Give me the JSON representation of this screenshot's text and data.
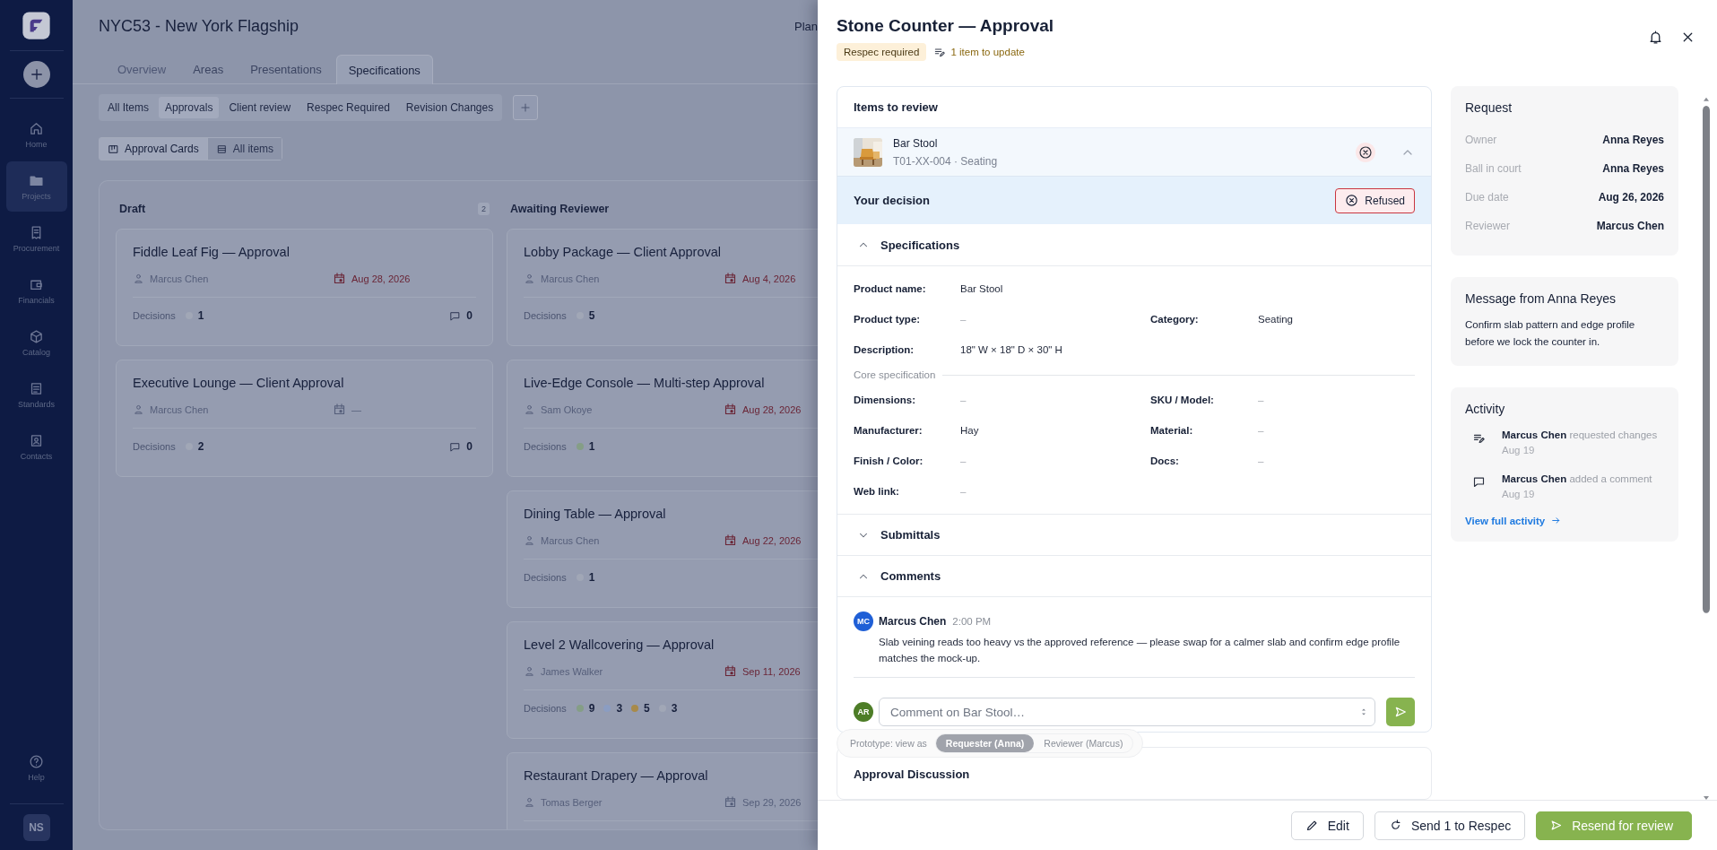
{
  "sidebar": {
    "items": [
      {
        "label": "Home",
        "selected": false
      },
      {
        "label": "Projects",
        "selected": true
      },
      {
        "label": "Procurement",
        "selected": false
      },
      {
        "label": "Financials",
        "selected": false
      },
      {
        "label": "Catalog",
        "selected": false
      },
      {
        "label": "Standards",
        "selected": false
      },
      {
        "label": "Contacts",
        "selected": false
      }
    ],
    "help": "Help",
    "avatar": "NS"
  },
  "project": {
    "title": "NYC53 - New York Flagship",
    "header_right": "Plan"
  },
  "tabs": [
    {
      "label": "Overview",
      "selected": false,
      "disabled": true
    },
    {
      "label": "Areas",
      "selected": false,
      "disabled": false
    },
    {
      "label": "Presentations",
      "selected": false,
      "disabled": false
    },
    {
      "label": "Specifications",
      "selected": true,
      "disabled": false
    }
  ],
  "subtabs": [
    {
      "label": "All Items",
      "selected": false
    },
    {
      "label": "Approvals",
      "selected": true
    },
    {
      "label": "Client review",
      "selected": false
    },
    {
      "label": "Respec Required",
      "selected": false
    },
    {
      "label": "Revision Changes",
      "selected": false
    }
  ],
  "views": [
    {
      "label": "Approval Cards",
      "selected": true
    },
    {
      "label": "All items",
      "selected": false
    }
  ],
  "board": {
    "columns": [
      {
        "title": "Draft",
        "count": "2",
        "cards": [
          {
            "title": "Fiddle Leaf Fig — Approval",
            "owner": "Marcus Chen",
            "due": "Aug 28, 2026",
            "due_overdue": true,
            "decisions_label": "Decisions",
            "decisions": [
              {
                "color": "#a1a7b6",
                "count": "1"
              }
            ],
            "comments": "0"
          },
          {
            "title": "Executive Lounge — Client Approval",
            "owner": "Marcus Chen",
            "due": "—",
            "due_overdue": false,
            "decisions_label": "Decisions",
            "decisions": [
              {
                "color": "#a1a7b6",
                "count": "2"
              }
            ],
            "comments": "0"
          }
        ]
      },
      {
        "title": "Awaiting Reviewer",
        "cards": [
          {
            "title": "Lobby Package — Client Approval",
            "owner": "Marcus Chen",
            "due": "Aug 4, 2026",
            "due_overdue": true,
            "decisions_label": "Decisions",
            "decisions": [
              {
                "color": "#a1a7b6",
                "count": "5"
              }
            ]
          },
          {
            "title": "Live-Edge Console — Multi-step Approval",
            "owner": "Sam Okoye",
            "due": "Aug 28, 2026",
            "due_overdue": true,
            "decisions_label": "Decisions",
            "decisions": [
              {
                "color": "#859e86",
                "count": "1"
              }
            ]
          },
          {
            "title": "Dining Table — Approval",
            "owner": "Marcus Chen",
            "due": "Aug 22, 2026",
            "due_overdue": true,
            "decisions_label": "Decisions",
            "decisions": [
              {
                "color": "#a1a7b6",
                "count": "1"
              }
            ]
          },
          {
            "title": "Level 2 Wallcovering — Approval",
            "owner": "James Walker",
            "due": "Sep 11, 2026",
            "due_overdue": true,
            "decisions_label": "Decisions",
            "decisions": [
              {
                "color": "#859e86",
                "count": "9"
              },
              {
                "color": "#8b9dc2",
                "count": "3"
              },
              {
                "color": "#a88a4a",
                "count": "5"
              },
              {
                "color": "#a1a7b6",
                "count": "3"
              }
            ]
          },
          {
            "title": "Restaurant Drapery — Approval",
            "owner": "Tomas Berger",
            "due": "Sep 29, 2026",
            "due_overdue": false
          }
        ]
      }
    ]
  },
  "panel": {
    "title": "Stone Counter — Approval",
    "status": "Respec required",
    "update_note": "1 item to update",
    "review": {
      "heading": "Items to review",
      "item": {
        "name": "Bar Stool",
        "meta": "T01-XX-004 · Seating",
        "expanded": true,
        "refused": true
      },
      "decision": {
        "label": "Your decision",
        "value": "Refused"
      },
      "specs": {
        "title": "Specifications",
        "expanded": true,
        "rows": [
          [
            {
              "label": "Product name:",
              "value": "Bar Stool"
            }
          ],
          [
            {
              "label": "Product type:",
              "value": "–"
            },
            {
              "label": "Category:",
              "value": "Seating"
            }
          ],
          [
            {
              "label": "Description:",
              "value": "18\" W × 18\" D × 30\" H"
            }
          ]
        ],
        "core_title": "Core specification",
        "core_rows": [
          [
            {
              "label": "Dimensions:",
              "value": "–"
            },
            {
              "label": "SKU / Model:",
              "value": "–"
            }
          ],
          [
            {
              "label": "Manufacturer:",
              "value": "Hay"
            },
            {
              "label": "Material:",
              "value": "–"
            }
          ],
          [
            {
              "label": "Finish / Color:",
              "value": "–"
            },
            {
              "label": "Docs:",
              "value": "–"
            }
          ],
          [
            {
              "label": "Web link:",
              "value": "–"
            }
          ]
        ]
      },
      "submittals": {
        "title": "Submittals",
        "expanded": false
      },
      "comments": {
        "title": "Comments",
        "expanded": true,
        "list": [
          {
            "initials": "MC",
            "color": "#1f5fd6",
            "author": "Marcus Chen",
            "time": "2:00 PM",
            "text": "Slab veining reads too heavy vs the approved reference — please swap for a calmer slab and confirm edge profile matches the mock-up."
          }
        ],
        "input": {
          "initials": "AR",
          "color": "#4d7d27",
          "placeholder": "Comment on Bar Stool…"
        }
      }
    },
    "prototype": {
      "label": "Prototype: view as",
      "options": [
        {
          "label": "Requester (Anna)",
          "selected": true
        },
        {
          "label": "Reviewer (Marcus)",
          "selected": false
        }
      ]
    },
    "discussion": {
      "title": "Approval Discussion"
    },
    "request": {
      "title": "Request",
      "rows": [
        {
          "label": "Owner",
          "value": "Anna Reyes"
        },
        {
          "label": "Ball in court",
          "value": "Anna Reyes"
        },
        {
          "label": "Due date",
          "value": "Aug 26, 2026"
        },
        {
          "label": "Reviewer",
          "value": "Marcus Chen"
        }
      ]
    },
    "message": {
      "title": "Message from Anna Reyes",
      "text": "Confirm slab pattern and edge profile before we lock the counter in."
    },
    "activity": {
      "title": "Activity",
      "items": [
        {
          "kind": "change",
          "text": "**Marcus Chen** requested changes",
          "date": "Aug 19"
        },
        {
          "kind": "comment",
          "text": "**Marcus Chen** added a comment",
          "date": "Aug 19"
        }
      ],
      "link": "View full activity"
    },
    "footer": [
      {
        "label": "Edit",
        "kind": "secondary"
      },
      {
        "label": "Send 1 to Respec",
        "kind": "secondary"
      },
      {
        "label": "Resend for review",
        "kind": "primary"
      }
    ]
  }
}
